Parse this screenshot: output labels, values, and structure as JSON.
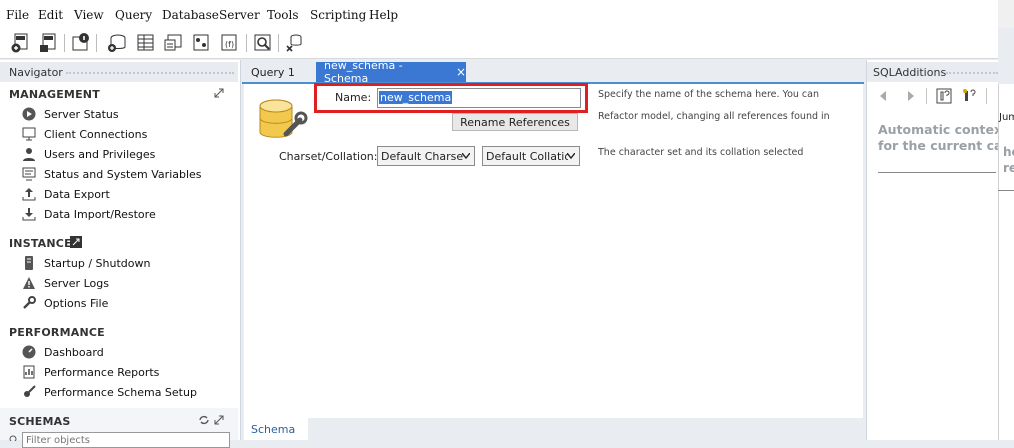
{
  "menu": [
    "File",
    "Edit",
    "View",
    "Query",
    "Database",
    "Server",
    "Tools",
    "Scripting",
    "Help"
  ],
  "navigator": {
    "title": "Navigator",
    "sections": {
      "management": {
        "title": "MANAGEMENT",
        "items": [
          "Server Status",
          "Client Connections",
          "Users and Privileges",
          "Status and System Variables",
          "Data Export",
          "Data Import/Restore"
        ]
      },
      "instance": {
        "title": "INSTANCE",
        "items": [
          "Startup / Shutdown",
          "Server Logs",
          "Options File"
        ]
      },
      "performance": {
        "title": "PERFORMANCE",
        "items": [
          "Dashboard",
          "Performance Reports",
          "Performance Schema Setup"
        ]
      },
      "schemas": {
        "title": "SCHEMAS",
        "filter_placeholder": "Filter objects"
      }
    }
  },
  "tabs": [
    {
      "label": "Query 1",
      "active": false
    },
    {
      "label": "new_schema - Schema",
      "active": true,
      "close": "×"
    }
  ],
  "schema_editor": {
    "name_label": "Name:",
    "name_value": "new_schema",
    "rename_button": "Rename References",
    "charset_label": "Charset/Collation:",
    "charset_value": "Default Charset",
    "collation_value": "Default Collation",
    "help_name_1": "Specify the name of the schema here. You can",
    "help_name_2": "Refactor model, changing all references found in",
    "help_charset": "The character set and its collation selected",
    "bottom_tab": "Schema"
  },
  "sql_additions": {
    "title": "SQLAdditions",
    "jump_label": "Jum",
    "context_line1": "Automatic context",
    "context_line2": "for the current ca",
    "side_text_1": "he",
    "side_text_2": "ret"
  },
  "colors": {
    "accent": "#4a8fd1",
    "highlight": "#e02020",
    "selection": "#3a78d4"
  }
}
